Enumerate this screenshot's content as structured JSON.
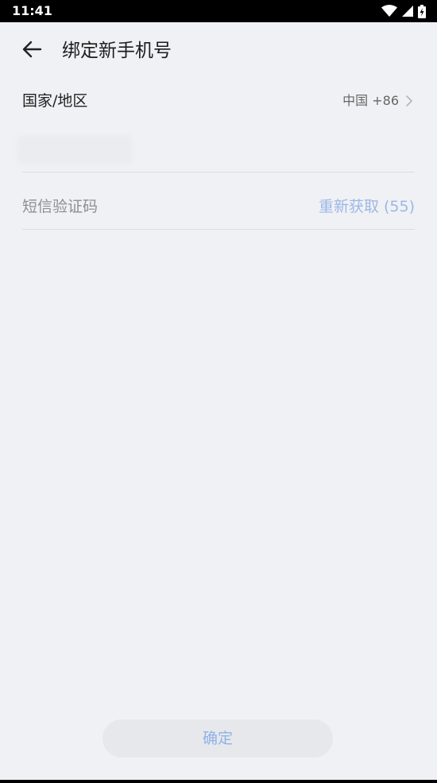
{
  "status_bar": {
    "time": "11:41",
    "icons": [
      "wifi-icon",
      "cell-signal-icon",
      "battery-charging-icon"
    ]
  },
  "header": {
    "back_icon": "arrow-left-icon",
    "title": "绑定新手机号"
  },
  "form": {
    "region": {
      "label": "国家/地区",
      "value": "中国 +86",
      "icon": "chevron-right-icon"
    },
    "phone": {
      "placeholder": ""
    },
    "sms": {
      "placeholder": "短信验证码",
      "resend_label": "重新获取 (55)"
    }
  },
  "confirm_button": {
    "label": "确定"
  },
  "colors": {
    "background": "#f0f1f4",
    "accent_disabled": "#9bb8e6",
    "divider": "#dcdde1"
  }
}
